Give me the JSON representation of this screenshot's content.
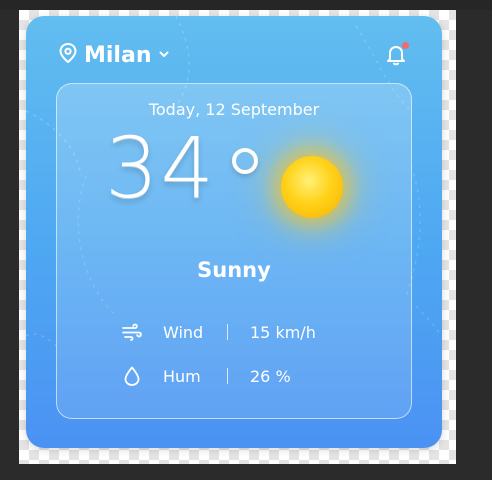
{
  "location": {
    "city": "Milan"
  },
  "date": "Today, 12 September",
  "weather": {
    "temperature": "34",
    "condition": "Sunny"
  },
  "details": [
    {
      "label": "Wind",
      "value": "15 km/h",
      "icon": "wind-icon"
    },
    {
      "label": "Hum",
      "value": "26 %",
      "icon": "droplet-icon"
    }
  ],
  "colors": {
    "card_top": "#62bdf0",
    "card_bottom": "#4b92f3",
    "sun": "#ffd21a",
    "notification_dot": "#f26a6a"
  }
}
